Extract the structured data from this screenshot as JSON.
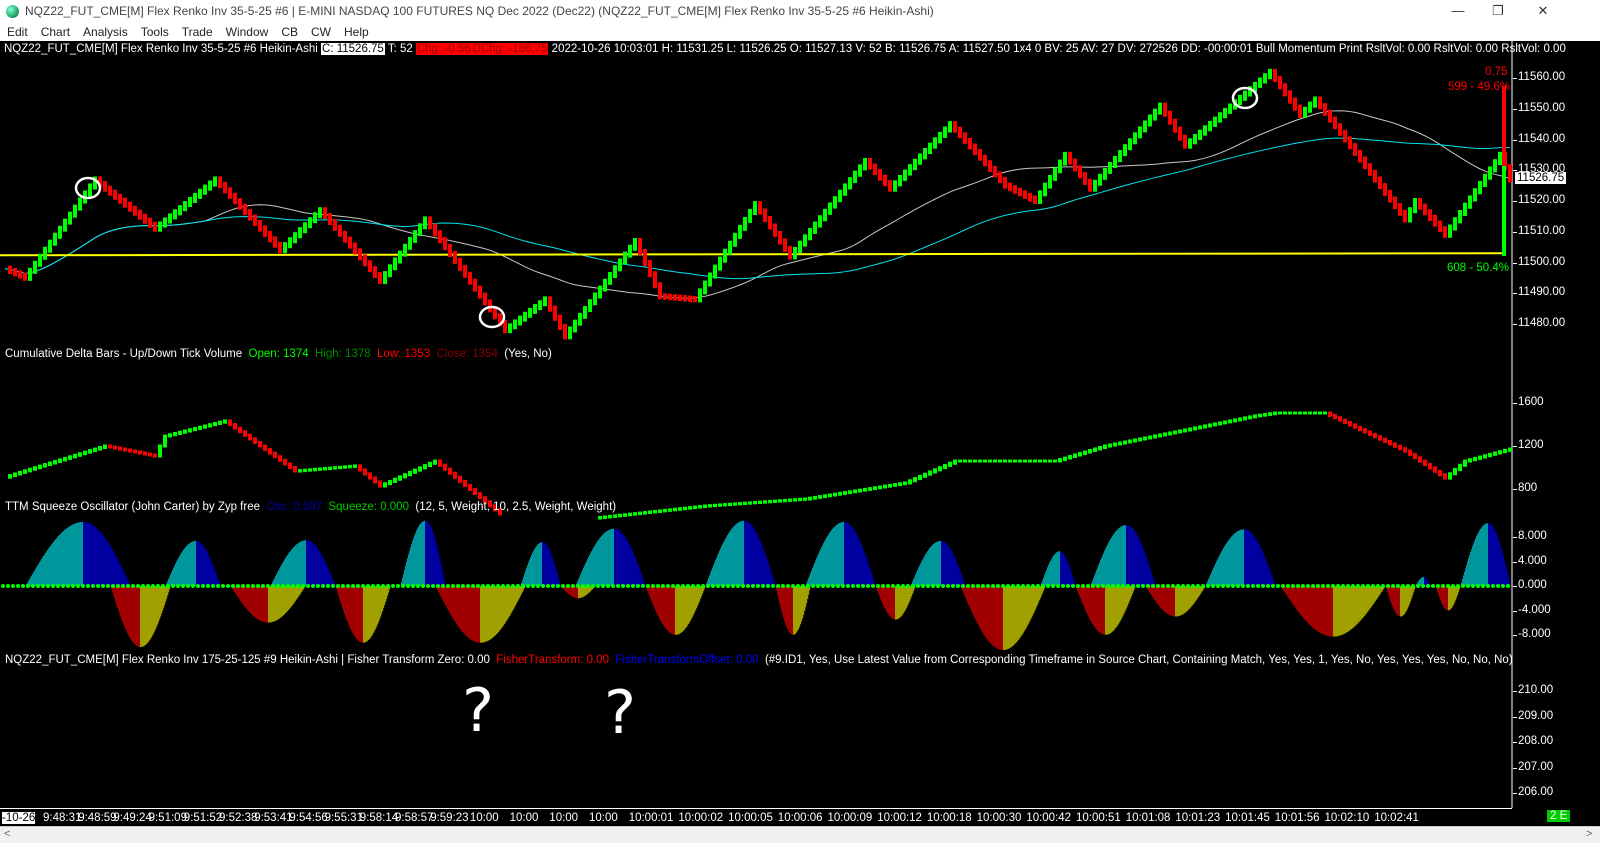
{
  "window": {
    "title": "NQZ22_FUT_CME[M]  Flex Renko Inv 35-5-25  #6 | E-MINI NASDAQ 100 FUTURES NQ Dec 2022 (Dec22) (NQZ22_FUT_CME[M]  Flex Renko Inv 35-5-25  #6 Heikin-Ashi)",
    "minimize": "—",
    "restore": "❐",
    "close": "✕"
  },
  "menu": [
    "Edit",
    "Chart",
    "Analysis",
    "Tools",
    "Trade",
    "Window",
    "CB",
    "CW",
    "Help"
  ],
  "info": {
    "symbol": "NQZ22_FUT_CME[M]  Flex Renko Inv 35-5-25  #6 Heikin-Ashi",
    "close": "C: 11526.75",
    "ticks": "T: 52",
    "chg": "Chg: -0.56",
    "dchg": "DChg: -186.75",
    "rest": "2022-10-26 10:03:01 H: 11531.25 L: 11526.25 O: 11527.13 V: 52 B: 11526.75 A: 11527.50 1x4 0 BV: 25 AV: 27 DV: 272526 DD: -00:00:01 Bull Momentum Print  RsltVol: 0.00  RsltVol: 0.00  RsltVol: 0.00"
  },
  "price_panel": {
    "axis": [
      "11560.00",
      "11550.00",
      "11540.00",
      "11530.00",
      "11520.00",
      "11510.00",
      "11500.00",
      "11490.00",
      "11480.00"
    ],
    "last_price": "11526.75",
    "tick_size": "0.75",
    "upper_stat": "599 - 49.6%",
    "lower_stat": "608 - 50.4%",
    "support_line": 11503,
    "colors": {
      "up": "#00ff00",
      "down": "#ff0000",
      "support": "#ffff00",
      "ma_slow": "#00e5ee",
      "ma_fast": "#c8c8c8"
    },
    "price_path": [
      [
        0,
        11498
      ],
      [
        4,
        11495
      ],
      [
        18,
        11527
      ],
      [
        20,
        11524
      ],
      [
        30,
        11511
      ],
      [
        42,
        11527
      ],
      [
        55,
        11504
      ],
      [
        63,
        11517
      ],
      [
        75,
        11494
      ],
      [
        84,
        11514
      ],
      [
        100,
        11478
      ],
      [
        108,
        11488
      ],
      [
        112,
        11476
      ],
      [
        126,
        11507
      ],
      [
        131,
        11489
      ],
      [
        138,
        11488
      ],
      [
        150,
        11519
      ],
      [
        157,
        11502
      ],
      [
        172,
        11533
      ],
      [
        177,
        11524
      ],
      [
        189,
        11545
      ],
      [
        200,
        11525
      ],
      [
        206,
        11520
      ],
      [
        212,
        11535
      ],
      [
        217,
        11524
      ],
      [
        231,
        11551
      ],
      [
        236,
        11538
      ],
      [
        253,
        11562
      ],
      [
        259,
        11548
      ],
      [
        262,
        11553
      ],
      [
        280,
        11514
      ],
      [
        282,
        11520
      ],
      [
        288,
        11509
      ],
      [
        299,
        11535
      ],
      [
        301,
        11527
      ]
    ]
  },
  "delta_panel": {
    "title": "Cumulative Delta Bars - Up/Down Tick Volume",
    "open": "Open: 1374",
    "high": "High: 1378",
    "low": "Low: 1353",
    "close": "Close: 1354",
    "params": "(Yes, No)",
    "axis": [
      "1600",
      "1200",
      "800"
    ],
    "path": [
      [
        0,
        910
      ],
      [
        5,
        984
      ],
      [
        20,
        1200
      ],
      [
        30,
        1107
      ],
      [
        32,
        1293
      ],
      [
        44,
        1433
      ],
      [
        58,
        967
      ],
      [
        70,
        1014
      ],
      [
        75,
        828
      ],
      [
        86,
        1060
      ],
      [
        100,
        530
      ],
      null,
      [
        118,
        530
      ],
      [
        140,
        642
      ],
      [
        160,
        707
      ],
      [
        180,
        856
      ],
      [
        190,
        1060
      ],
      [
        210,
        1060
      ],
      [
        220,
        1200
      ],
      [
        250,
        1480
      ],
      [
        254,
        1507
      ],
      [
        264,
        1507
      ],
      [
        280,
        1153
      ],
      [
        288,
        902
      ],
      [
        292,
        1060
      ],
      [
        301,
        1172
      ]
    ]
  },
  "ttm_panel": {
    "title": "TTM Squeeze Oscillator (John Carter) by Zyp free",
    "osc": "Osc: 0.587",
    "squeeze": "Squeeze: 0.000",
    "params": "(12, 5, Weight, 10, 2.5, Weight, Weight)",
    "axis": [
      "8.000",
      "4.000",
      "0.000",
      "-4.000",
      "-8.000"
    ],
    "colors": {
      "pos_up": "#00979c",
      "pos_down": "#0000a0",
      "neg_down": "#a00000",
      "neg_up": "#a0a000",
      "squeeze_dot": "#00ff00"
    },
    "humps": [
      [
        4,
        25,
        10.5
      ],
      [
        21,
        33,
        -10
      ],
      [
        32,
        43,
        7.4
      ],
      [
        45,
        60,
        -6
      ],
      [
        53,
        66,
        7.5
      ],
      [
        66,
        77,
        -9.3
      ],
      [
        79,
        88,
        10.7
      ],
      [
        86,
        104,
        -9.3
      ],
      [
        103,
        111,
        7.2
      ],
      [
        111,
        118,
        -2
      ],
      [
        114,
        128,
        9.4
      ],
      [
        128,
        140,
        -8
      ],
      [
        140,
        154,
        10.7
      ],
      [
        154,
        161,
        -8
      ],
      [
        160,
        174,
        10.5
      ],
      [
        174,
        182,
        -5.5
      ],
      [
        181,
        192,
        7.4
      ],
      [
        191,
        208,
        -10.5
      ],
      [
        207,
        214,
        5.7
      ],
      [
        214,
        226,
        -8
      ],
      [
        217,
        230,
        10
      ],
      [
        228,
        240,
        -5
      ],
      [
        240,
        254,
        9.3
      ],
      [
        255,
        276,
        -8.3
      ],
      [
        276,
        282,
        -5
      ],
      [
        282,
        285,
        1.5
      ],
      [
        286,
        291,
        -4
      ],
      [
        291,
        301,
        10.3
      ]
    ]
  },
  "fisher_panel": {
    "title": "NQZ22_FUT_CME[M]  Flex Renko Inv 175-25-125  #9 Heikin-Ashi | Fisher Transform  Zero: 0.00",
    "ft": "FisherTransform: 0.00",
    "fto": "FisherTransformOffset: 0.00",
    "params": "(#9.ID1, Yes, Use Latest Value from Corresponding Timeframe in Source Chart, Containing Match, Yes, Yes, 1, Yes, No, Yes, Yes, Yes, No, No, No)",
    "axis": [
      "210.00",
      "209.00",
      "208.00",
      "207.00",
      "206.00"
    ],
    "annotations": [
      "?",
      "?"
    ]
  },
  "time_axis": [
    "-10-26",
    "9:48:31",
    "9:48:59",
    "9:49:24",
    "9:51:09",
    "9:51:52",
    "9:52:38",
    "9:53:41",
    "9:54:56",
    "9:55:31",
    "9:58:14",
    "9:58:57",
    "9:59:23",
    "10:00",
    "10:00",
    "10:00",
    "10:00",
    "10:00:01",
    "10:00:02",
    "10:00:05",
    "10:00:06",
    "10:00:09",
    "10:00:12",
    "10:00:18",
    "10:00:30",
    "10:00:42",
    "10:00:51",
    "10:01:08",
    "10:01:23",
    "10:01:45",
    "10:01:56",
    "10:02:10",
    "10:02:41"
  ],
  "status_badge": "2 E"
}
